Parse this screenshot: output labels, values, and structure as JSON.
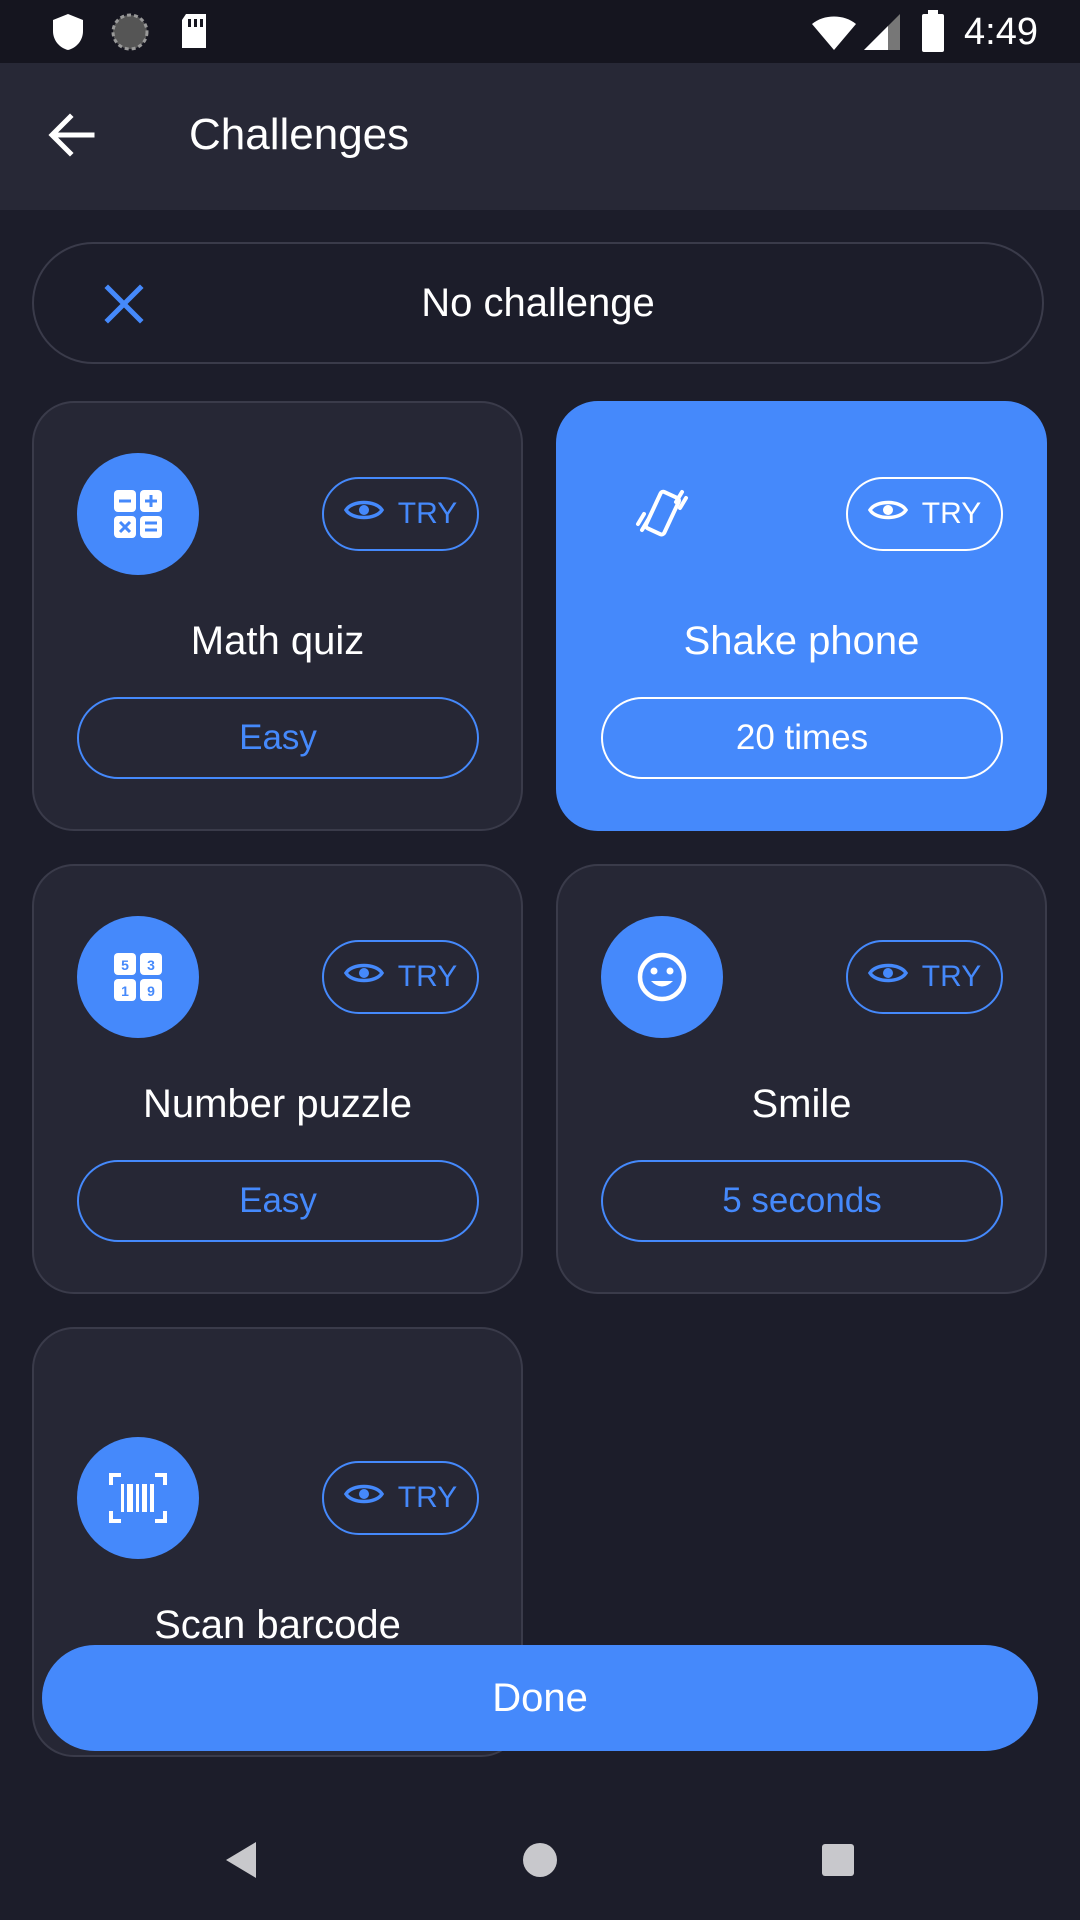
{
  "status_bar": {
    "time": "4:49",
    "icons": [
      "shield-icon",
      "sync-icon",
      "sd-card-icon",
      "wifi-icon",
      "signal-icon",
      "battery-icon"
    ]
  },
  "app_bar": {
    "title": "Challenges",
    "back_icon": "arrow-back-icon"
  },
  "no_challenge": {
    "label": "No challenge",
    "icon": "close-icon"
  },
  "cards": [
    {
      "title": "Math quiz",
      "try_label": "TRY",
      "option": "Easy",
      "icon": "math-icon",
      "selected": false
    },
    {
      "title": "Shake phone",
      "try_label": "TRY",
      "option": "20 times",
      "icon": "vibrate-phone-icon",
      "selected": true
    },
    {
      "title": "Number puzzle",
      "try_label": "TRY",
      "option": "Easy",
      "icon": "number-grid-icon",
      "selected": false
    },
    {
      "title": "Smile",
      "try_label": "TRY",
      "option": "5 seconds",
      "icon": "smile-icon",
      "selected": false
    },
    {
      "title": "Scan barcode",
      "try_label": "TRY",
      "option": "",
      "icon": "barcode-scan-icon",
      "selected": false
    }
  ],
  "done_label": "Done",
  "colors": {
    "background": "#1c1d2a",
    "surface": "#262735",
    "accent": "#4589fb",
    "appbar": "#272836"
  },
  "nav": {
    "icons": [
      "nav-back-icon",
      "nav-home-icon",
      "nav-recents-icon"
    ]
  }
}
